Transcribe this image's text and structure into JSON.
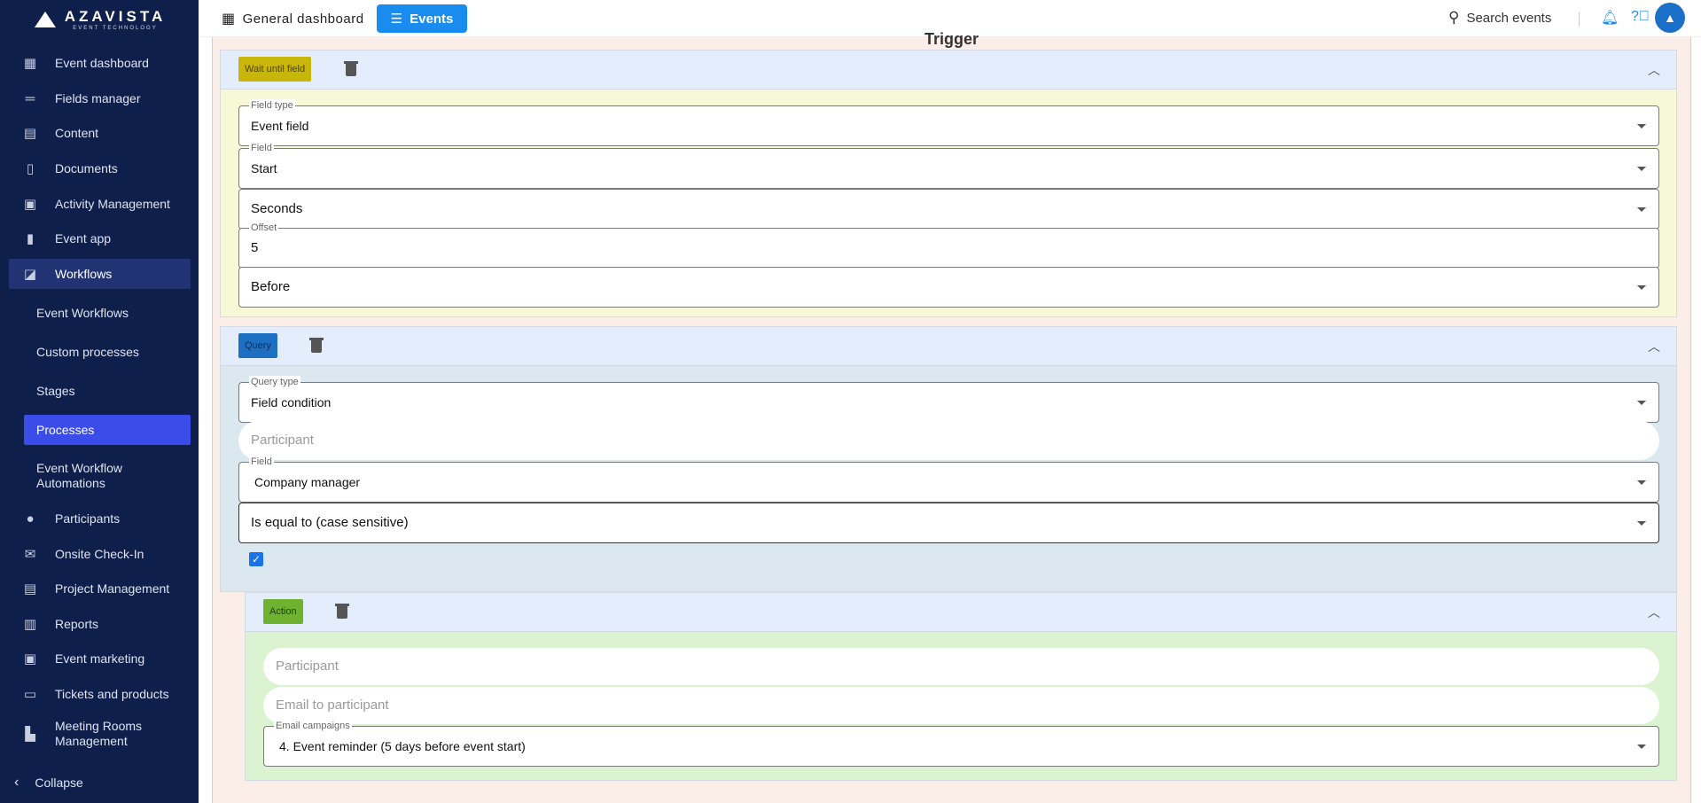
{
  "brand": {
    "name": "AZAVISTA",
    "tagline": "EVENT TECHNOLOGY"
  },
  "sidebar": {
    "items": [
      {
        "label": "Event dashboard",
        "icon": "dashboard-icon"
      },
      {
        "label": "Fields manager",
        "icon": "fields-icon"
      },
      {
        "label": "Content",
        "icon": "content-icon"
      },
      {
        "label": "Documents",
        "icon": "document-icon"
      },
      {
        "label": "Activity Management",
        "icon": "calendar-icon"
      },
      {
        "label": "Event app",
        "icon": "phone-icon"
      },
      {
        "label": "Workflows",
        "icon": "workflow-icon"
      },
      {
        "label": "Participants",
        "icon": "person-icon"
      },
      {
        "label": "Onsite Check-In",
        "icon": "mail-icon"
      },
      {
        "label": "Project Management",
        "icon": "project-icon"
      },
      {
        "label": "Reports",
        "icon": "chart-icon"
      },
      {
        "label": "Event marketing",
        "icon": "calendar-icon"
      },
      {
        "label": "Tickets and products",
        "icon": "card-icon"
      },
      {
        "label": "Meeting Rooms Management",
        "icon": "room-icon"
      }
    ],
    "subitems": [
      {
        "label": "Event Workflows"
      },
      {
        "label": "Custom processes"
      },
      {
        "label": "Stages"
      },
      {
        "label": "Processes"
      },
      {
        "label": "Event Workflow Automations"
      }
    ],
    "collapse_label": "Collapse"
  },
  "topbar": {
    "general_dashboard": "General dashboard",
    "events": "Events",
    "search_placeholder": "Search events"
  },
  "trigger": {
    "title": "Trigger",
    "chip": "Wait until field",
    "fields": {
      "field_type_label": "Field type",
      "field_type_value": "Event field",
      "field_label": "Field",
      "field_value": "Start",
      "unit_value": "Seconds",
      "offset_label": "Offset",
      "offset_value": "5",
      "direction_value": "Before"
    }
  },
  "query": {
    "chip": "Query",
    "fields": {
      "query_type_label": "Query type",
      "query_type_value": "Field condition",
      "participant_placeholder": "Participant",
      "field_label": "Field",
      "field_value": "Company manager",
      "operator_value": "Is equal to (case sensitive)"
    },
    "checked": true
  },
  "action": {
    "chip": "Action",
    "fields": {
      "participant_placeholder": "Participant",
      "email_placeholder": "Email to participant",
      "campaigns_label": "Email campaigns",
      "campaigns_value": "4. Event reminder (5 days before event start)"
    }
  },
  "colors": {
    "sidebar_bg": "#0f1f4b",
    "active_sub": "#3b4ce8",
    "accent": "#1a8cf0",
    "trigger_body": "#f6f8d6",
    "trigger_chip": "#c9b60b",
    "query_body": "#dbe8f0",
    "query_chip": "#1d6fc2",
    "action_body": "#dcf3d2",
    "action_chip": "#6fb230"
  }
}
